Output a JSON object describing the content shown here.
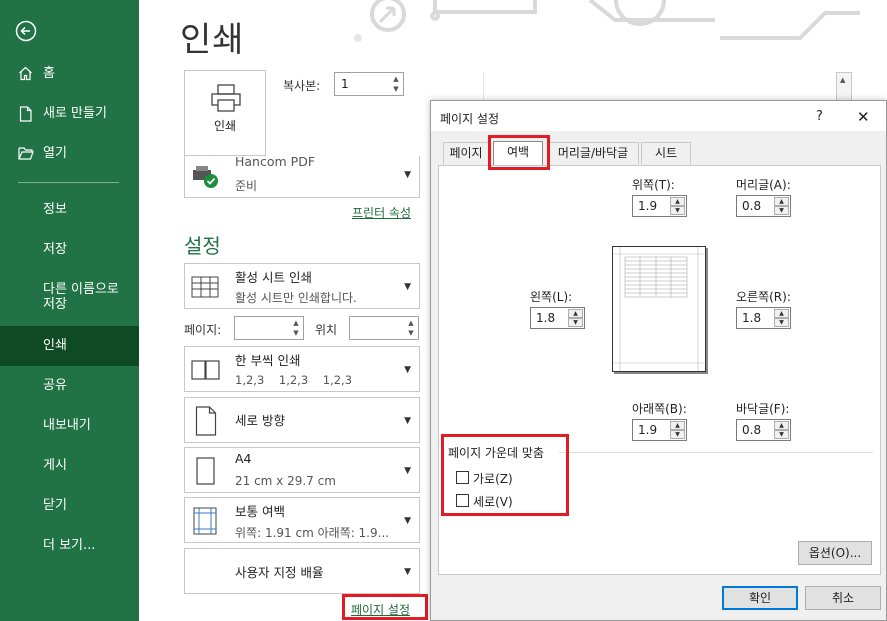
{
  "sidebar": {
    "back_icon": "back-arrow-icon",
    "items": [
      {
        "label": "홈",
        "icon": "home-icon"
      },
      {
        "label": "새로 만들기",
        "icon": "new-document-icon"
      },
      {
        "label": "열기",
        "icon": "folder-open-icon"
      },
      {
        "label": "정보"
      },
      {
        "label": "저장"
      },
      {
        "label": "다른 이름으로\n저장"
      },
      {
        "label": "인쇄",
        "active": true
      },
      {
        "label": "공유"
      },
      {
        "label": "내보내기"
      },
      {
        "label": "게시"
      },
      {
        "label": "닫기"
      },
      {
        "label": "더 보기..."
      }
    ]
  },
  "print": {
    "title": "인쇄",
    "print_button": "인쇄",
    "copies_label": "복사본:",
    "copies_value": "1",
    "printer_name": "Hancom PDF",
    "printer_status": "준비",
    "printer_properties": "프린터 속성",
    "settings_title": "설정",
    "scope_title": "활성 시트 인쇄",
    "scope_desc": "활성 시트만 인쇄합니다.",
    "pages_label": "페이지:",
    "pages_to_label": "위치",
    "collate_title": "한 부씩 인쇄",
    "collate_desc": "1,2,3    1,2,3    1,2,3",
    "orientation": "세로 방향",
    "paper_title": "A4",
    "paper_desc": "21 cm x 29.7 cm",
    "margins_title": "보통 여백",
    "margins_desc": "위쪽: 1.91 cm 아래쪽: 1.9...",
    "scaling": "사용자 지정 배율",
    "page_setup_link": "페이지 설정"
  },
  "dialog": {
    "title": "페이지 설정",
    "help": "?",
    "close": "✕",
    "tabs": [
      "페이지",
      "여백",
      "머리글/바닥글",
      "시트"
    ],
    "active_tab": "여백",
    "top_label": "위쪽(T):",
    "top_value": "1.9",
    "header_label": "머리글(A):",
    "header_value": "0.8",
    "left_label": "왼쪽(L):",
    "left_value": "1.8",
    "right_label": "오른쪽(R):",
    "right_value": "1.8",
    "bottom_label": "아래쪽(B):",
    "bottom_value": "1.9",
    "footer_label": "바닥글(F):",
    "footer_value": "0.8",
    "center_title": "페이지 가운데 맞춤",
    "horizontal": "가로(Z)",
    "vertical": "세로(V)",
    "options": "옵션(O)...",
    "ok": "확인",
    "cancel": "취소"
  },
  "colors": {
    "sidebar": "#217346",
    "active": "#0e4a24",
    "highlight": "#e21b24"
  }
}
